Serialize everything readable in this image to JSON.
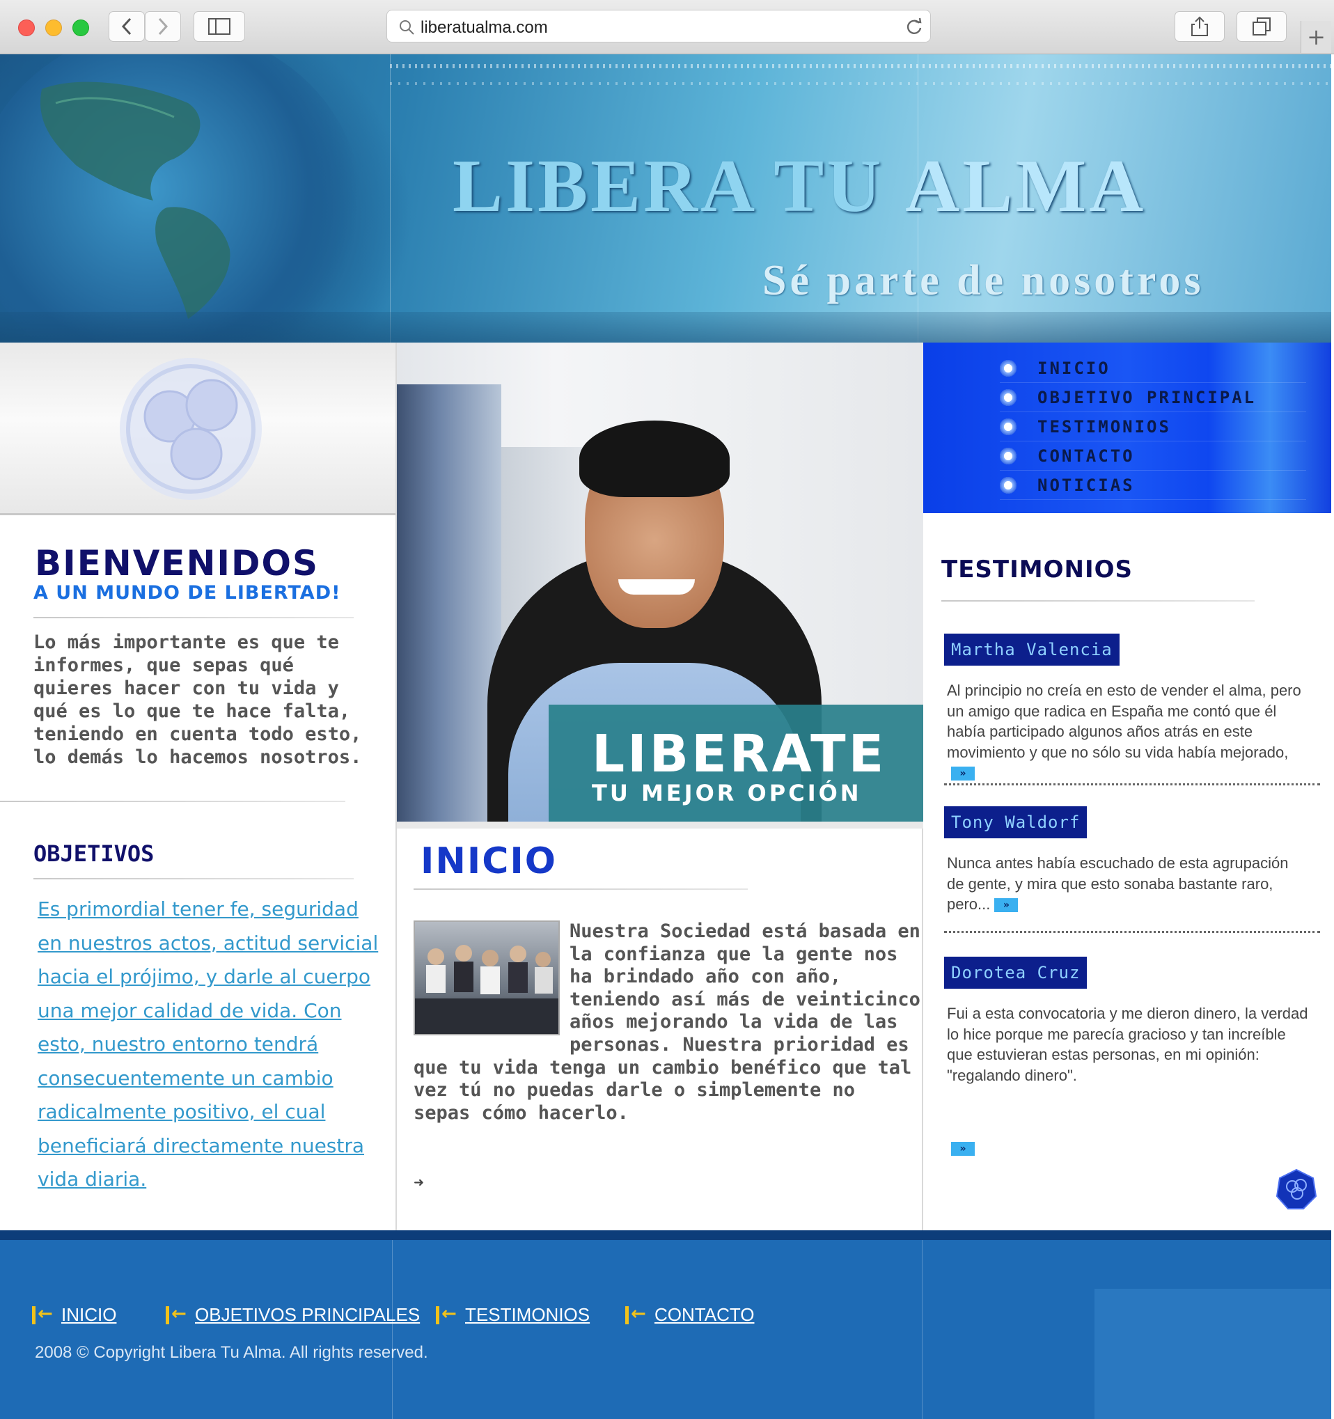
{
  "browser": {
    "url": "liberatualma.com"
  },
  "banner": {
    "title_main": "LIBERA TU ",
    "title_accent": "ALMA",
    "subtitle": "Sé parte de nosotros"
  },
  "nav": {
    "items": [
      {
        "label": "INICIO"
      },
      {
        "label": "OBJETIVO PRINCIPAL"
      },
      {
        "label": "TESTIMONIOS"
      },
      {
        "label": "CONTACTO"
      },
      {
        "label": "NOTICIAS"
      }
    ]
  },
  "welcome": {
    "heading": "BIENVENIDOS",
    "subheading": "A UN MUNDO DE LIBERTAD!",
    "body": "Lo más importante es que te informes, que sepas qué quieres hacer con tu vida y qué es lo que te hace falta, teniendo en cuenta todo esto, lo demás lo hacemos nosotros."
  },
  "objectives": {
    "heading": "OBJETIVOS",
    "body": "Es primordial tener fe, seguridad en nuestros actos, actitud servicial hacia el prójimo, y darle al cuerpo una mejor calidad de vida. Con esto, nuestro entorno tendrá consecuentemente un cambio radicalmente positivo, el cual beneficiará directamente nuestra vida diaria."
  },
  "hero": {
    "headline": "LIBERATE",
    "tagline": "TU MEJOR OPCIÓN"
  },
  "inicio": {
    "heading": "INICIO",
    "body": "Nuestra Sociedad está basada en la confianza que la gente nos ha brindado año con año, teniendo así más de veinticinco años mejorando la vida de las personas. Nuestra prioridad es que tu vida tenga un cambio benéfico que tal vez tú no puedas darle o simplemente no sepas cómo hacerlo."
  },
  "testimonials": {
    "heading": "TESTIMONIOS",
    "items": [
      {
        "name": "Martha Valencia",
        "text": "Al principio no creía en esto de vender el alma, pero un amigo que radica en España me contó que él había participado algunos años atrás en este movimiento y que no sólo su vida había mejorado,"
      },
      {
        "name": "Tony Waldorf",
        "text": "Nunca antes había escuchado de esta agrupación de gente, y mira que esto sonaba bastante raro, pero..."
      },
      {
        "name": "Dorotea Cruz",
        "text": "Fui  a esta convocatoria y me dieron dinero, la verdad lo hice porque me parecía gracioso y tan increíble que estuvieran estas personas, en mi opinión: \"regalando dinero\"."
      }
    ],
    "more_glyph": "»"
  },
  "footer": {
    "links": [
      {
        "label": "INICIO"
      },
      {
        "label": "OBJETIVOS PRINCIPALES"
      },
      {
        "label": "TESTIMONIOS"
      },
      {
        "label": "CONTACTO"
      }
    ],
    "copyright": "2008 © Copyright Libera Tu Alma. All rights reserved."
  },
  "colors": {
    "nav_blue": "#1a56f5",
    "footer_blue": "#1e6bb5",
    "heading_navy": "#10106a",
    "link_cyan": "#3399cc"
  }
}
